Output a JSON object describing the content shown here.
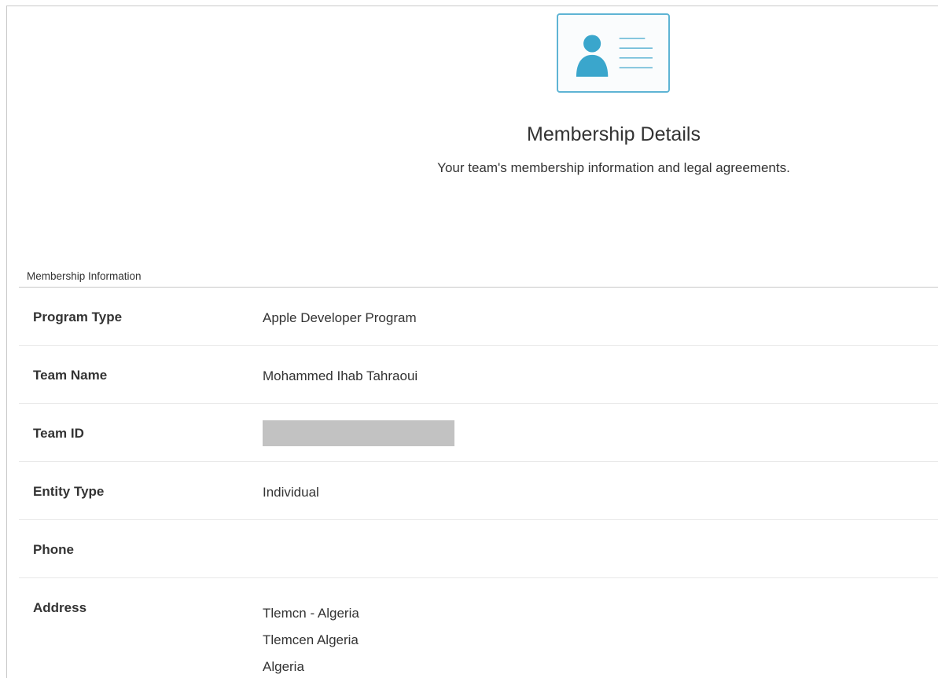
{
  "header": {
    "icon": "id-card-icon",
    "title": "Membership Details",
    "subtitle": "Your team's membership information and legal agreements."
  },
  "section": {
    "label": "Membership Information"
  },
  "rows": [
    {
      "label": "Program Type",
      "value": "Apple Developer Program"
    },
    {
      "label": "Team Name",
      "value": "Mohammed Ihab Tahraoui"
    },
    {
      "label": "Team ID",
      "value": ""
    },
    {
      "label": "Entity Type",
      "value": "Individual"
    },
    {
      "label": "Phone",
      "value": ""
    },
    {
      "label": "Address",
      "lines": [
        "Tlemcn - Algeria",
        "Tlemcen Algeria",
        "Algeria"
      ]
    }
  ],
  "colors": {
    "accent": "#3aa6cc",
    "redaction": "#c2c2c2"
  }
}
